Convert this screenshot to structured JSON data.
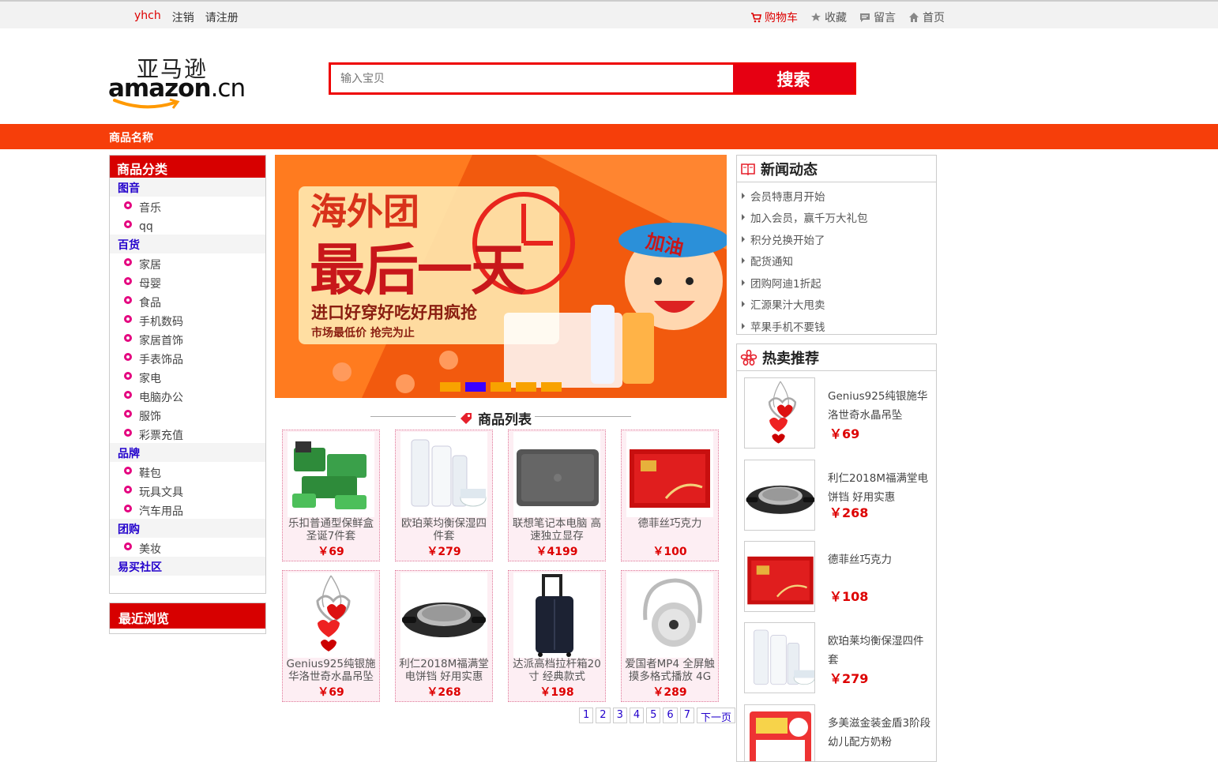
{
  "topbar": {
    "user": "yhch",
    "logout": "注销",
    "register": "请注册",
    "cart": "购物车",
    "favorites": "收藏",
    "message": "留言",
    "home": "首页"
  },
  "logo": {
    "cn": "亚马逊",
    "en_bold": "amazon",
    "en_light": ".cn"
  },
  "search": {
    "placeholder": "输入宝贝",
    "button": "搜索"
  },
  "nav": {
    "label": "商品名称"
  },
  "categories": {
    "title": "商品分类",
    "groups": [
      {
        "name": "图音",
        "items": [
          "音乐",
          "qq"
        ]
      },
      {
        "name": "百货",
        "items": [
          "家居",
          "母婴",
          "食品",
          "手机数码",
          "家居首饰",
          "手表饰品",
          "家电",
          "电脑办公",
          "服饰",
          "彩票充值"
        ]
      },
      {
        "name": "品牌",
        "items": [
          "鞋包",
          "玩具文具",
          "汽车用品"
        ]
      },
      {
        "name": "团购",
        "items": [
          "美妆"
        ]
      },
      {
        "name": "易买社区",
        "items": []
      }
    ]
  },
  "recent": {
    "title": "最近浏览"
  },
  "banner": {
    "line1": "海外团",
    "line2": "最后一天",
    "line3": "进口好穿好吃好用疯抢",
    "line4": "市场最低价 抢完为止",
    "badge": "加油",
    "active_slide": 2,
    "slide_count": 5
  },
  "product_list": {
    "title": "商品列表",
    "products": [
      {
        "name": "乐扣普通型保鲜盒圣诞7件套",
        "price": "￥69",
        "icon": "food-container-set"
      },
      {
        "name": "欧珀莱均衡保湿四件套",
        "price": "￥279",
        "icon": "skincare-set"
      },
      {
        "name": "联想笔记本电脑 高速独立显存",
        "price": "￥4199",
        "icon": "laptop"
      },
      {
        "name": "德菲丝巧克力",
        "price": "￥100",
        "icon": "chocolate-box"
      },
      {
        "name": "Genius925纯银施华洛世奇水晶吊坠",
        "price": "￥69",
        "icon": "heart-pendant"
      },
      {
        "name": "利仁2018M福满堂电饼铛 好用实惠",
        "price": "￥268",
        "icon": "electric-pan"
      },
      {
        "name": "达派高档拉杆箱20寸 经典款式",
        "price": "￥198",
        "icon": "suitcase"
      },
      {
        "name": "爱国者MP4 全屏触摸多格式播放 4G",
        "price": "￥289",
        "icon": "earphone"
      }
    ]
  },
  "pager": {
    "pages": [
      "1",
      "2",
      "3",
      "4",
      "5",
      "6",
      "7"
    ],
    "next": "下一页"
  },
  "news": {
    "title": "新闻动态",
    "items": [
      "会员特惠月开始",
      "加入会员，赢千万大礼包",
      "积分兑换开始了",
      "配货通知",
      "团购阿迪1折起",
      "汇源果汁大甩卖",
      "苹果手机不要钱"
    ]
  },
  "hot": {
    "title": "热卖推荐",
    "items": [
      {
        "name": "Genius925纯银施华洛世奇水晶吊坠",
        "price": "￥69",
        "icon": "heart-pendant"
      },
      {
        "name": "利仁2018M福满堂电饼铛 好用实惠",
        "price": "￥268",
        "icon": "electric-pan"
      },
      {
        "name": "德菲丝巧克力",
        "price": "￥108",
        "icon": "chocolate-box"
      },
      {
        "name": "欧珀莱均衡保湿四件套",
        "price": "￥279",
        "icon": "skincare-set"
      },
      {
        "name": "多美滋金装金盾3阶段幼儿配方奶粉",
        "price": "",
        "icon": "milk-powder"
      }
    ]
  },
  "colors": {
    "brand_red": "#e60012",
    "nav_orange": "#f63e0a",
    "link_blue": "#2200cc"
  }
}
